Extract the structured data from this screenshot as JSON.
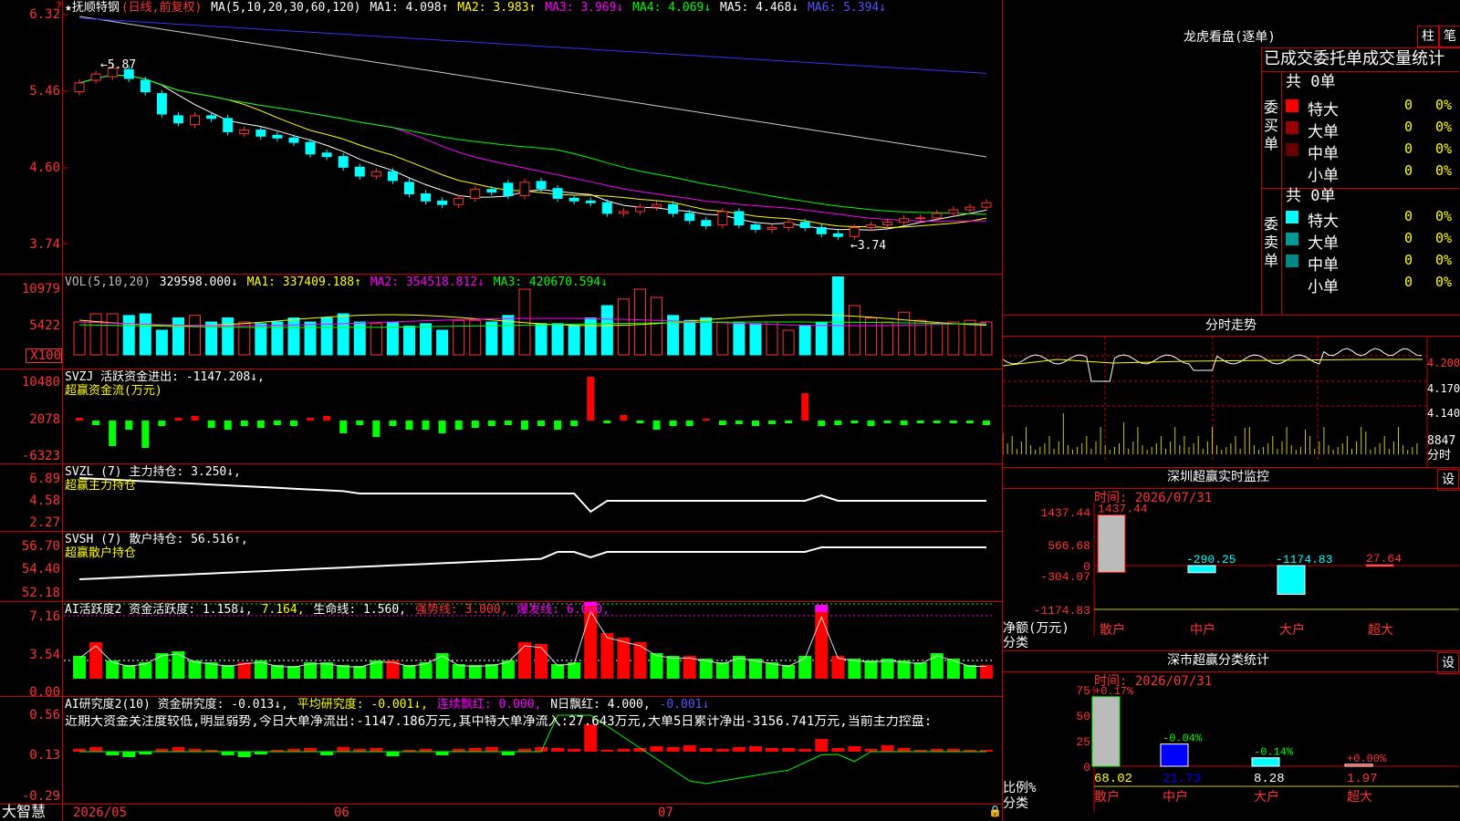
{
  "stock": {
    "name": "★抚顺特钢",
    "mode": "(日线,前复权)",
    "ma_label": "MA(5,10,20,30,60,120)",
    "ma": [
      {
        "t": "MA1: 4.098↑",
        "c": "w"
      },
      {
        "t": "MA2: 3.983↑",
        "c": "y"
      },
      {
        "t": "MA3: 3.969↓",
        "c": "m"
      },
      {
        "t": "MA4: 4.069↓",
        "c": "g"
      },
      {
        "t": "MA5: 4.468↓",
        "c": "w"
      },
      {
        "t": "MA6: 5.394↓",
        "c": "b"
      }
    ],
    "yticks": [
      "6.32",
      "5.46",
      "4.60",
      "3.74"
    ],
    "hi_label": "←5.87",
    "lo_label": "←3.74"
  },
  "vol": {
    "header": [
      {
        "t": "VOL(5,10,20)",
        "c": "gr"
      },
      {
        "t": "329598.000↓",
        "c": "w"
      },
      {
        "t": "MA1: 337409.188↑",
        "c": "y"
      },
      {
        "t": "MA2: 354518.812↓",
        "c": "m"
      },
      {
        "t": "MA3: 420670.594↓",
        "c": "g"
      }
    ],
    "yticks": [
      "10979",
      "5422"
    ],
    "unit": "X100"
  },
  "svzj": {
    "header": [
      {
        "t": "SVZJ  活跃资金进出: -1147.208↓,",
        "c": "w"
      }
    ],
    "sub": "超赢资金流(万元)",
    "yticks": [
      "10480",
      "2078",
      "-6323"
    ]
  },
  "svzl": {
    "header": [
      {
        "t": "SVZL (7) 主力持仓: 3.250↓,",
        "c": "w"
      }
    ],
    "sub": "超赢主力持仓",
    "yticks": [
      "6.89",
      "4.58",
      "2.27"
    ]
  },
  "svsh": {
    "header": [
      {
        "t": "SVSH (7) 散户持仓: 56.516↑,",
        "c": "w"
      }
    ],
    "sub": "超赢散户持仓",
    "yticks": [
      "56.70",
      "54.40",
      "52.18"
    ]
  },
  "ai1": {
    "header": [
      {
        "t": "AI活跃度2 资金活跃度: 1.158↓,",
        "c": "w"
      },
      {
        "t": "7.164,",
        "c": "y"
      },
      {
        "t": "生命线: 1.560,",
        "c": "w"
      },
      {
        "t": "强势线: 3.000,",
        "c": "r"
      },
      {
        "t": "爆发线: 6.000,",
        "c": "m"
      }
    ],
    "yticks": [
      "7.16",
      "3.54",
      "0.00"
    ]
  },
  "ai2": {
    "header": [
      {
        "t": "AI研究度2(10) 资金研究度: -0.013↓,",
        "c": "w"
      },
      {
        "t": "平均研究度: -0.001↓,",
        "c": "y"
      },
      {
        "t": "连续飘红: 0.000,",
        "c": "m"
      },
      {
        "t": "N日飘红: 4.000,",
        "c": "w"
      },
      {
        "t": "-0.001↓",
        "c": "b"
      }
    ],
    "text": "近期大资金关注度较低,明显弱势,今日大单净流出:-1147.186万元,其中特大单净流入:27.643万元,大单5日累计净出-3156.741万元,当前主力控盘:",
    "yticks": [
      "0.56",
      "0.13",
      "-0.29"
    ]
  },
  "xaxis": {
    "app": "大智慧",
    "labels": [
      "2026/05",
      "06",
      "07"
    ]
  },
  "dragon": {
    "title": "龙虎看盘(逐单)",
    "btn1": "柱",
    "btn2": "笔",
    "subtitle": "已成交委托单成交量统计",
    "buy_total": "共 0单",
    "buy_label": "委买单",
    "sell_total": "共 0单",
    "sell_label": "委卖单",
    "buy": [
      {
        "n": "特大",
        "v": "0",
        "p": "0%",
        "c": "#f00"
      },
      {
        "n": "大单",
        "v": "0",
        "p": "0%",
        "c": "#900"
      },
      {
        "n": "中单",
        "v": "0",
        "p": "0%",
        "c": "#600"
      },
      {
        "n": "小单",
        "v": "0",
        "p": "0%",
        "c": "#000"
      }
    ],
    "sell": [
      {
        "n": "特大",
        "v": "0",
        "p": "0%",
        "c": "#0ff"
      },
      {
        "n": "大单",
        "v": "0",
        "p": "0%",
        "c": "#099"
      },
      {
        "n": "中单",
        "v": "0",
        "p": "0%",
        "c": "#088"
      },
      {
        "n": "小单",
        "v": "0",
        "p": "0%",
        "c": "#000"
      }
    ]
  },
  "intraday": {
    "title": "分时走势",
    "yticks": [
      "4.200",
      "4.170",
      "4.140"
    ],
    "vol_label": "8847",
    "unit": "分时"
  },
  "monitor": {
    "title": "深圳超赢实时监控",
    "set": "设",
    "time": "时间: 2026/07/31",
    "yticks": [
      "1437.44",
      "566.68",
      "0",
      "-304.07",
      "-1174.83"
    ],
    "unit1": "净额(万元)",
    "unit2": "分类",
    "bars": [
      {
        "name": "散户",
        "value": 1437.44,
        "label": "1437.44"
      },
      {
        "name": "中户",
        "value": -290.25,
        "label": "-290.25"
      },
      {
        "name": "大户",
        "value": -1174.83,
        "label": "-1174.83"
      },
      {
        "name": "超大",
        "value": 27.64,
        "label": "27.64"
      }
    ]
  },
  "classify": {
    "title": "深市超赢分类统计",
    "set": "设",
    "time": "时间: 2026/07/31",
    "yticks": [
      "75",
      "50",
      "25",
      "0"
    ],
    "unit1": "比例%",
    "unit2": "分类",
    "bars": [
      {
        "name": "散户",
        "pct": 68.02,
        "chg": "+0.17%"
      },
      {
        "name": "中户",
        "pct": 21.73,
        "chg": "-0.04%"
      },
      {
        "name": "大户",
        "pct": 8.28,
        "chg": "-0.14%"
      },
      {
        "name": "超大",
        "pct": 1.97,
        "chg": "+0.00%"
      }
    ]
  },
  "chart_data": {
    "type": "candlestick",
    "ylim": [
      3.74,
      6.32
    ],
    "close": [
      5.55,
      5.65,
      5.72,
      5.6,
      5.45,
      5.2,
      5.1,
      5.18,
      5.15,
      5.0,
      5.02,
      4.95,
      4.93,
      4.88,
      4.75,
      4.72,
      4.6,
      4.5,
      4.55,
      4.45,
      4.3,
      4.22,
      4.18,
      4.25,
      4.35,
      4.32,
      4.28,
      4.43,
      4.36,
      4.25,
      4.22,
      4.2,
      4.08,
      4.1,
      4.15,
      4.18,
      4.08,
      4.0,
      3.94,
      4.1,
      3.95,
      3.9,
      3.92,
      3.98,
      3.92,
      3.85,
      3.82,
      3.92,
      3.95,
      3.98,
      4.02,
      4.03,
      4.08,
      4.12,
      4.15,
      4.2
    ],
    "open": [
      5.45,
      5.58,
      5.62,
      5.7,
      5.58,
      5.43,
      5.18,
      5.08,
      5.18,
      5.15,
      4.98,
      5.02,
      4.96,
      4.93,
      4.88,
      4.76,
      4.72,
      4.6,
      4.5,
      4.55,
      4.43,
      4.3,
      4.22,
      4.18,
      4.25,
      4.35,
      4.42,
      4.28,
      4.44,
      4.36,
      4.25,
      4.22,
      4.2,
      4.08,
      4.1,
      4.15,
      4.18,
      4.08,
      4.0,
      3.95,
      4.1,
      3.95,
      3.9,
      3.92,
      3.98,
      3.92,
      3.85,
      3.82,
      3.92,
      3.95,
      3.98,
      4.02,
      4.03,
      4.08,
      4.12,
      4.15
    ]
  }
}
